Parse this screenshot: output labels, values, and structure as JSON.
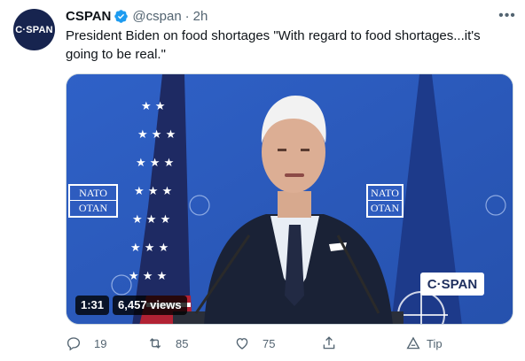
{
  "author": {
    "avatar_text": "C·SPAN",
    "name": "CSPAN",
    "handle": "@cspan",
    "separator": "·",
    "time": "2h"
  },
  "tweet_text": "President Biden on food shortages \"With regard to food shortages...it's going to be real.\"",
  "media": {
    "sign_text_top": "NATO",
    "sign_text_bottom": "OTAN",
    "logo": "C·SPAN",
    "duration": "1:31",
    "views": "6,457 views"
  },
  "actions": {
    "reply_count": "19",
    "retweet_count": "85",
    "like_count": "75",
    "tip_label": "Tip"
  },
  "colors": {
    "accent": "#1d9bf0",
    "secondary_text": "#536471",
    "backdrop_blue": "#2c58b8"
  },
  "icons": [
    "verified-badge-icon",
    "more-icon",
    "reply-icon",
    "retweet-icon",
    "like-icon",
    "share-icon",
    "tip-icon"
  ]
}
